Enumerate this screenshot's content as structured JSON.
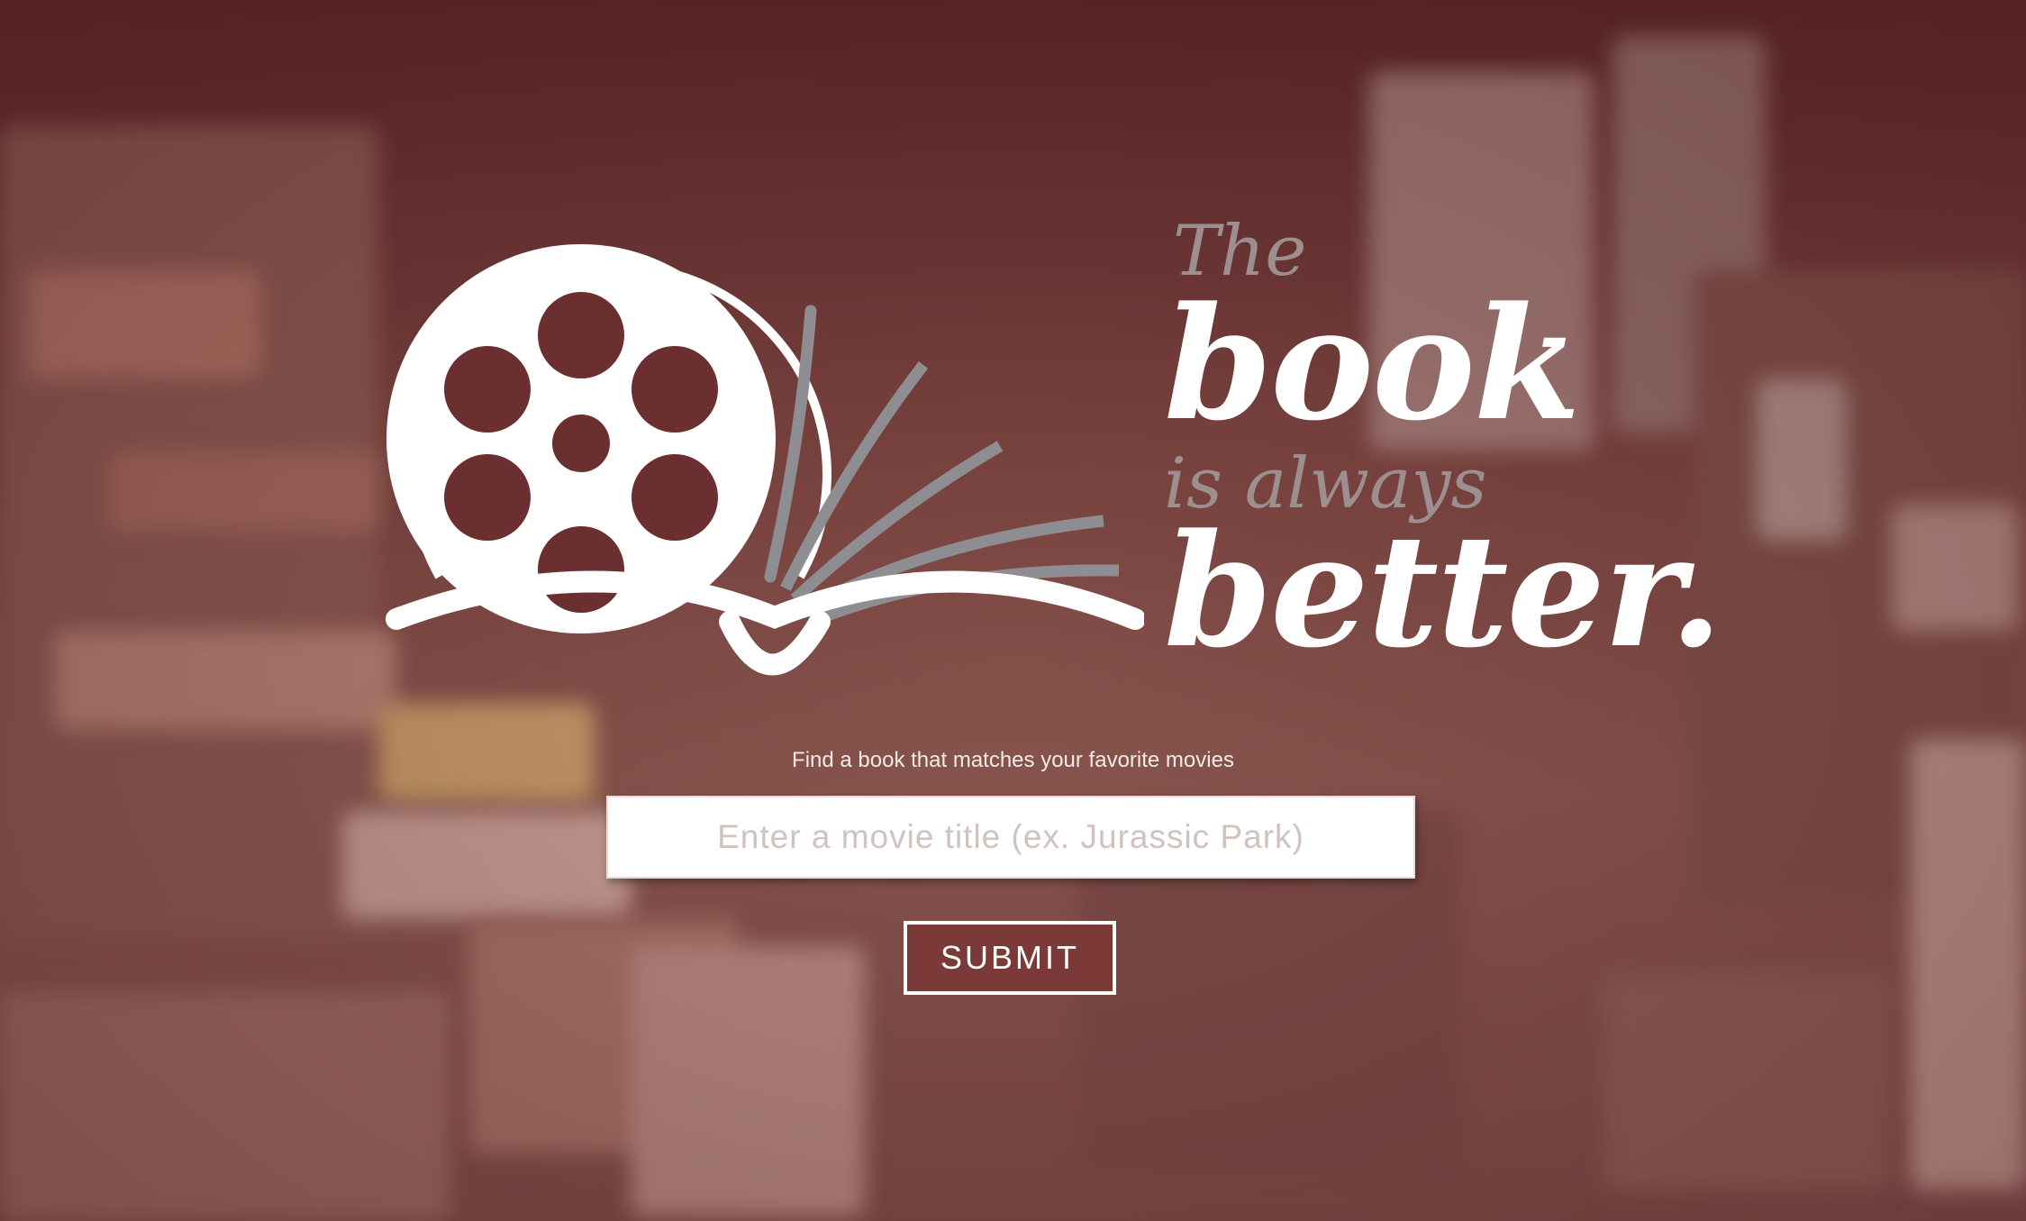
{
  "header": {
    "tagline_the": "The",
    "tagline_book": "book",
    "tagline_always": "is always",
    "tagline_better": "better."
  },
  "logo": {
    "icon": "film-reel-book-icon"
  },
  "search": {
    "subtitle": "Find a book that matches your favorite movies",
    "placeholder": "Enter a movie title (ex. Jurassic Park)",
    "submit_label": "SUBMIT"
  },
  "colors": {
    "background": "#6e3a38",
    "accent": "#7b3a38",
    "logo_white": "#ffffff",
    "logo_gray": "#8e8d92"
  }
}
